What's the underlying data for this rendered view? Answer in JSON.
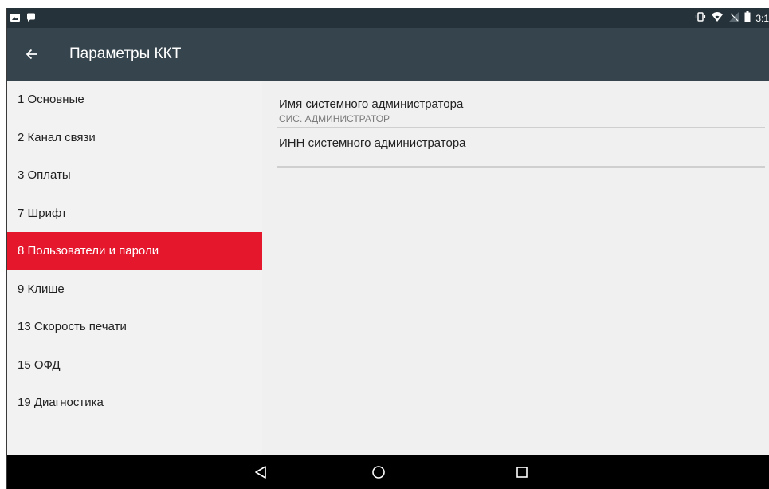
{
  "status_bar": {
    "time": "3:1",
    "icons": [
      "image-icon",
      "chat-icon",
      "vibrate-icon",
      "wifi-icon",
      "no-signal-icon",
      "battery-icon"
    ]
  },
  "toolbar": {
    "title": "Параметры ККТ",
    "back_icon": "arrow-back-icon"
  },
  "sidebar": {
    "items": [
      {
        "label": "1 Основные",
        "selected": false
      },
      {
        "label": "2 Канал связи",
        "selected": false
      },
      {
        "label": "3 Оплаты",
        "selected": false
      },
      {
        "label": "7 Шрифт",
        "selected": false
      },
      {
        "label": "8 Пользователи и пароли",
        "selected": true
      },
      {
        "label": "9 Клише",
        "selected": false
      },
      {
        "label": "13 Скорость печати",
        "selected": false
      },
      {
        "label": "15 ОФД",
        "selected": false
      },
      {
        "label": "19 Диагностика",
        "selected": false
      }
    ]
  },
  "content": {
    "preferences": [
      {
        "title": "Имя системного администратора",
        "summary": "СИС. АДМИНИСТРАТОР"
      },
      {
        "title": "ИНН системного администратора",
        "summary": ""
      }
    ]
  },
  "colors": {
    "status_bar": "#26323a",
    "toolbar": "#35444d",
    "accent": "#e4172d",
    "navbar": "#000000"
  },
  "navbar": {
    "icons": [
      "nav-back-icon",
      "nav-home-icon",
      "nav-recents-icon"
    ]
  }
}
